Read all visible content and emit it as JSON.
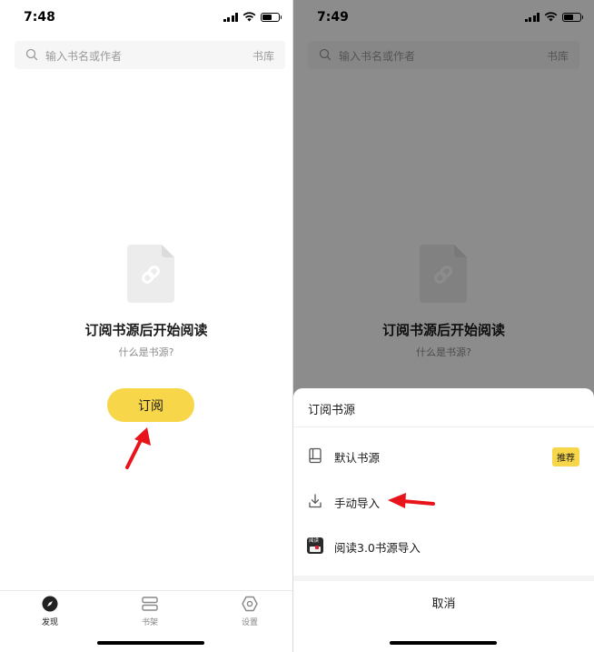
{
  "colors": {
    "accent": "#f7d64a",
    "text_primary": "#1a1a1a",
    "text_secondary": "#8a8a8a",
    "annotation_arrow": "#e8141b"
  },
  "left_screen": {
    "status": {
      "time": "7:48"
    },
    "search": {
      "placeholder": "输入书名或作者",
      "library_label": "书库"
    },
    "empty_state": {
      "icon": "link-document-icon",
      "title": "订阅书源后开始阅读",
      "help_link": "什么是书源?"
    },
    "subscribe_button": "订阅",
    "tab_bar": {
      "items": [
        {
          "label": "发现",
          "icon": "compass-icon",
          "active": true
        },
        {
          "label": "书架",
          "icon": "bookshelf-icon",
          "active": false
        },
        {
          "label": "设置",
          "icon": "settings-icon",
          "active": false
        }
      ]
    }
  },
  "right_screen": {
    "status": {
      "time": "7:49"
    },
    "search": {
      "placeholder": "输入书名或作者",
      "library_label": "书库"
    },
    "empty_state": {
      "title": "订阅书源后开始阅读",
      "help_link": "什么是书源?"
    },
    "sheet": {
      "title": "订阅书源",
      "items": [
        {
          "label": "默认书源",
          "icon": "book-icon",
          "badge": "推荐"
        },
        {
          "label": "手动导入",
          "icon": "download-icon"
        },
        {
          "label": "阅读3.0书源导入",
          "icon": "yuedu-app-icon",
          "app_icon_text": "阅读"
        }
      ],
      "cancel": "取消"
    }
  }
}
